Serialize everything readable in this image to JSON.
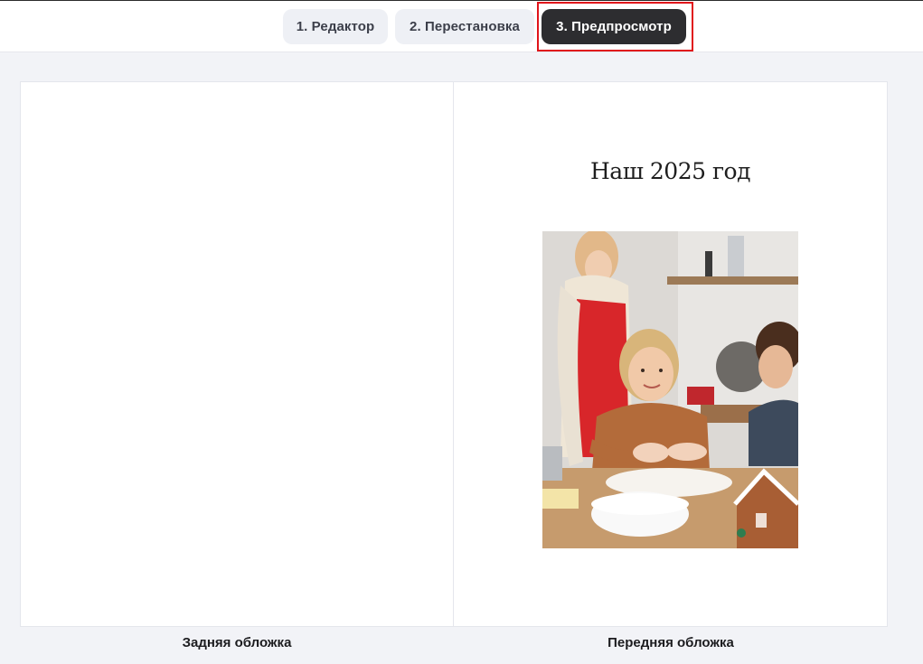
{
  "tabs": [
    {
      "label": "1. Редактор",
      "active": false
    },
    {
      "label": "2. Перестановка",
      "active": false
    },
    {
      "label": "3. Предпросмотр",
      "active": true
    }
  ],
  "front_cover": {
    "title": "Наш 2025 год",
    "photo": "family-baking-photo"
  },
  "captions": {
    "back": "Задняя обложка",
    "front": "Передняя обложка"
  },
  "colors": {
    "active_tab": "#2d2d30",
    "inactive_tab": "#eef0f5",
    "highlight": "#e0141b",
    "background": "#f2f3f7"
  }
}
